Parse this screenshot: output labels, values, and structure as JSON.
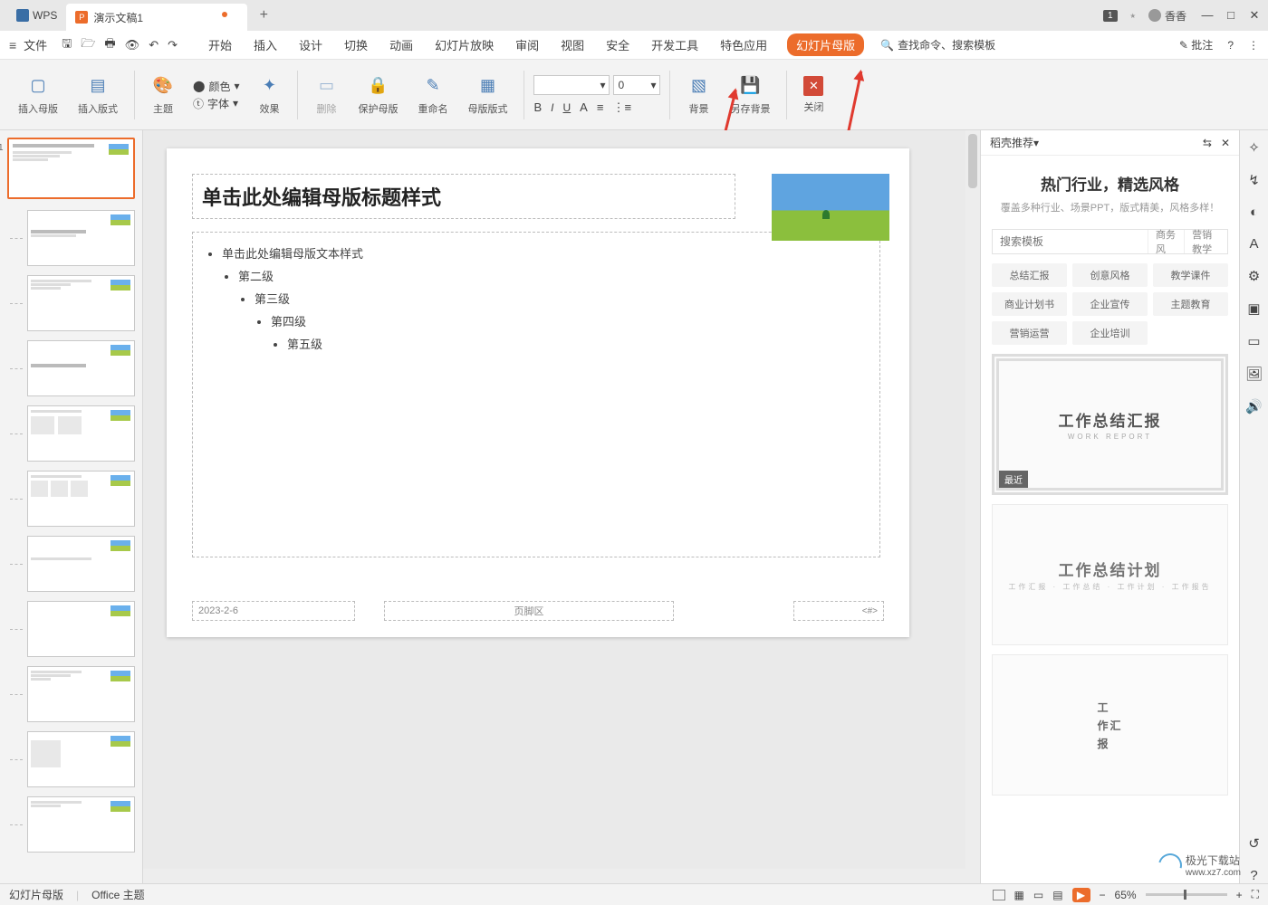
{
  "titlebar": {
    "logo": "WPS",
    "doc_name": "演示文稿1",
    "add": "+",
    "badge": "1",
    "user": "香香"
  },
  "window": {
    "min": "—",
    "max": "□",
    "close": "✕"
  },
  "menubar": {
    "file": "文件",
    "tabs": [
      "开始",
      "插入",
      "设计",
      "切换",
      "动画",
      "幻灯片放映",
      "审阅",
      "视图",
      "安全",
      "开发工具",
      "特色应用",
      "幻灯片母版"
    ],
    "active": "幻灯片母版",
    "search": "查找命令、搜索模板",
    "note": "批注",
    "help": "?"
  },
  "ribbon": {
    "insert_master": "插入母版",
    "insert_layout": "插入版式",
    "theme": "主题",
    "color": "颜色",
    "font": "字体",
    "effect": "效果",
    "delete": "删除",
    "protect": "保护母版",
    "rename": "重命名",
    "layout_fmt": "母版版式",
    "font_name": "",
    "font_size": "0",
    "bg": "背景",
    "save_bg": "另存背景",
    "close": "关闭"
  },
  "slide": {
    "title": "单击此处编辑母版标题样式",
    "b1": "单击此处编辑母版文本样式",
    "b2": "第二级",
    "b3": "第三级",
    "b4": "第四级",
    "b5": "第五级",
    "date": "2023-2-6",
    "footer": "页脚区",
    "num": "<#>"
  },
  "promo": {
    "header": "稻壳推荐",
    "hero_title": "热门行业，精选风格",
    "hero_sub": "覆盖多种行业、场景PPT，版式精美，风格多样！",
    "placeholder": "搜索模板",
    "btn1": "商务风",
    "btn2": "营销教学",
    "tags": [
      "总结汇报",
      "创意风格",
      "教学课件",
      "商业计划书",
      "企业宣传",
      "主题教育",
      "营销运营",
      "企业培训"
    ],
    "tpl1": "工作总结汇报",
    "tpl1_sub": "WORK REPORT",
    "badge": "最近",
    "tpl2": "工作总结计划",
    "tpl2_sub": "工作汇报 · 工作总结 · 工作计划 · 工作报告",
    "tpl3a": "工",
    "tpl3b": "作汇",
    "tpl3c": "报"
  },
  "status": {
    "left1": "幻灯片母版",
    "left2": "Office 主题",
    "zoom": "65%"
  },
  "watermark": {
    "t1": "极光下载站",
    "t2": "www.xz7.com"
  }
}
